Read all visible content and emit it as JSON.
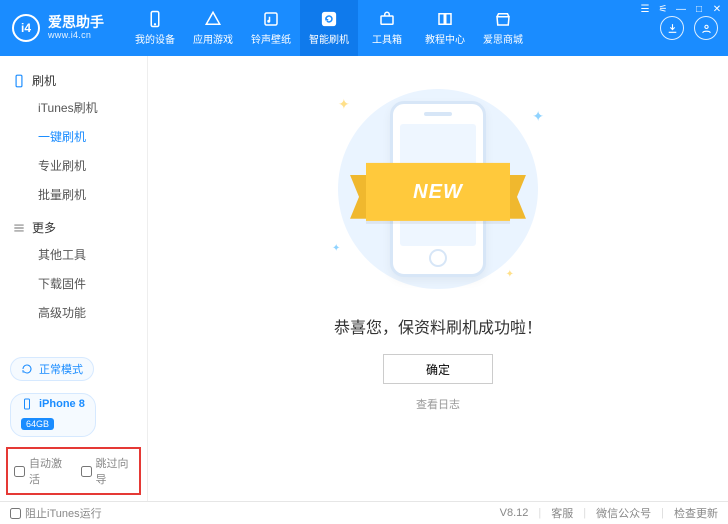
{
  "app": {
    "name": "爱思助手",
    "url": "www.i4.cn",
    "badge": "i4"
  },
  "nav": {
    "items": [
      {
        "label": "我的设备",
        "icon": "phone"
      },
      {
        "label": "应用游戏",
        "icon": "apps"
      },
      {
        "label": "铃声壁纸",
        "icon": "note"
      },
      {
        "label": "智能刷机",
        "icon": "refresh",
        "active": true
      },
      {
        "label": "工具箱",
        "icon": "toolbox"
      },
      {
        "label": "教程中心",
        "icon": "book"
      },
      {
        "label": "爱思商城",
        "icon": "shop"
      }
    ]
  },
  "win": {
    "menu": "☰",
    "pin": "⚟",
    "min": "—",
    "max": "□",
    "close": "✕"
  },
  "sidebar": {
    "section1": {
      "title": "刷机",
      "items": [
        {
          "label": "iTunes刷机"
        },
        {
          "label": "一键刷机",
          "active": true
        },
        {
          "label": "专业刷机"
        },
        {
          "label": "批量刷机"
        }
      ]
    },
    "section2": {
      "title": "更多",
      "items": [
        {
          "label": "其他工具"
        },
        {
          "label": "下载固件"
        },
        {
          "label": "高级功能"
        }
      ]
    },
    "mode_label": "正常模式",
    "device": {
      "name": "iPhone 8",
      "capacity": "64GB"
    },
    "checks": {
      "auto_activate": "自动激活",
      "skip_guide": "跳过向导"
    }
  },
  "content": {
    "ribbon": "NEW",
    "success": "恭喜您，保资料刷机成功啦！",
    "ok": "确定",
    "view_log": "查看日志"
  },
  "footer": {
    "block_itunes": "阻止iTunes运行",
    "version": "V8.12",
    "support": "客服",
    "wechat": "微信公众号",
    "update": "检查更新"
  }
}
